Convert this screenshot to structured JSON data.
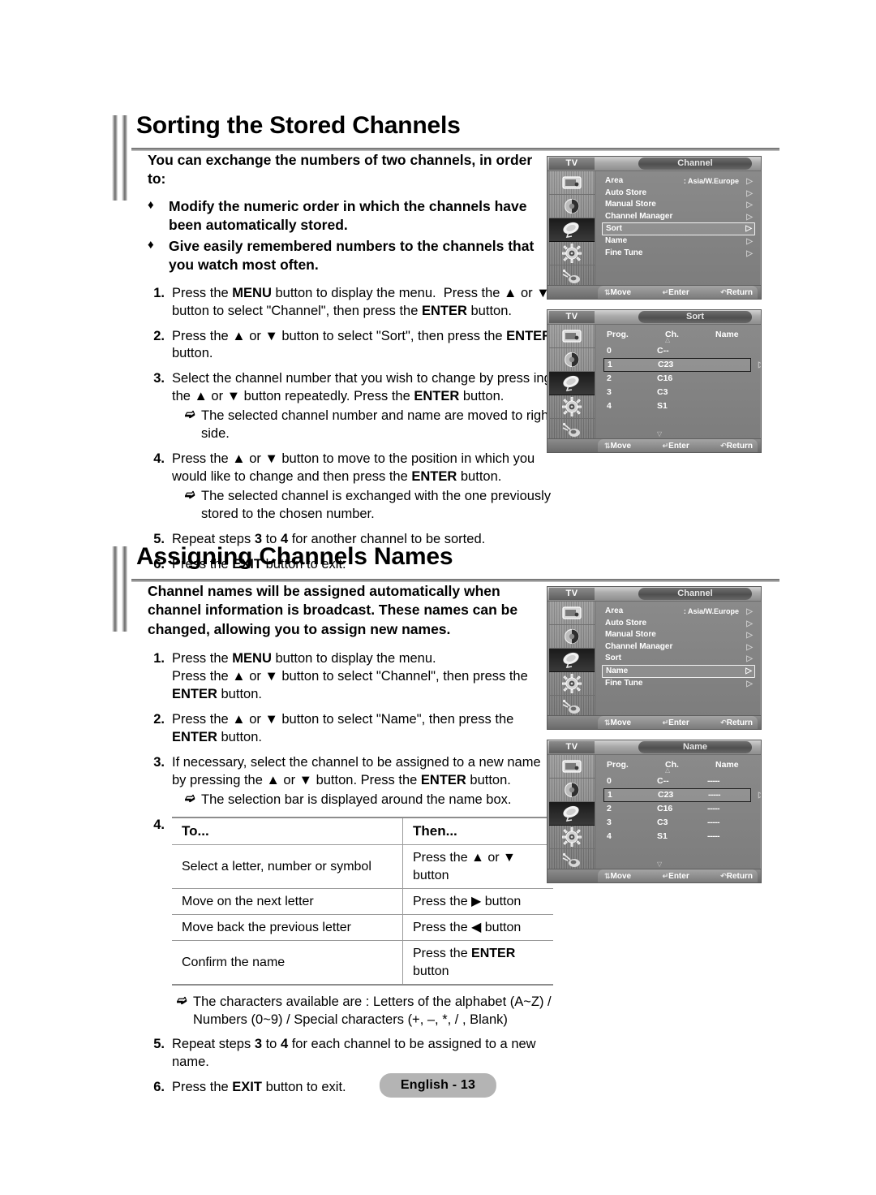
{
  "page": {
    "footer_badge": "English - 13"
  },
  "sections": [
    {
      "heading": "Sorting the Stored Channels",
      "intro": "You can exchange the numbers of two channels, in order to:",
      "bullet_marker": "♦",
      "bullets": [
        "Modify the numeric order in which the channels have been automatically stored.",
        "Give easily remembered numbers to the channels that you watch most often."
      ],
      "steps": [
        {
          "num": "1.",
          "html": "Press the <b>MENU</b> button to display the menu.&nbsp; Press the ▲ or ▼ button to select \"Channel\", then press the <b>ENTER</b> button."
        },
        {
          "num": "2.",
          "html": "Press the ▲ or ▼ button to select \"Sort\", then press the <b>ENTER</b> button."
        },
        {
          "num": "3.",
          "html": "Select the channel number that you wish to change by press ing the ▲ or ▼ button repeatedly. Press the <b>ENTER</b> button.",
          "note": "The selected channel number and name are moved to right side."
        },
        {
          "num": "4.",
          "html": "Press the ▲ or ▼ button to move to the position in which you would like to change and then press the <b>ENTER</b> button.",
          "note": "The selected channel is exchanged with the one previously stored to the chosen number."
        },
        {
          "num": "5.",
          "html": "Repeat steps <b>3</b> to <b>4</b> for another channel to be sorted."
        },
        {
          "num": "6.",
          "html": "Press the <b>EXIT</b> button to exit."
        }
      ]
    },
    {
      "heading": "Assigning Channels Names",
      "intro": "Channel names will be assigned automatically when channel information is broadcast. These names can be changed, allowing you to assign new names.",
      "steps": [
        {
          "num": "1.",
          "html": "Press the <b>MENU</b> button to display the menu.<br>Press the ▲ or ▼ button to select \"Channel\", then press the <b>ENTER</b> button."
        },
        {
          "num": "2.",
          "html": "Press the ▲ or ▼ button to select \"Name\", then press the <b>ENTER</b> button."
        },
        {
          "num": "3.",
          "html": "If necessary, select the channel to be assigned to a new name by pressing the ▲ or ▼ button. Press the <b>ENTER</b> button.",
          "note": "The selection bar is displayed around the name box."
        }
      ],
      "table_step_num": "4.",
      "table": {
        "headers": [
          "To...",
          "Then..."
        ],
        "rows": [
          {
            "to": "Select a letter, number or symbol",
            "then": "Press the ▲ or ▼ button"
          },
          {
            "to": "Move on the next letter",
            "then": "Press the ▶ button"
          },
          {
            "to": "Move back the previous letter",
            "then": "Press the ◀ button"
          },
          {
            "to": "Confirm the name",
            "then": "Press the <b>ENTER</b> button"
          }
        ]
      },
      "after_table_note": "The characters available are : Letters of the alphabet (A~Z) / Numbers (0~9) / Special characters (+, –, *, / , Blank)",
      "steps_after": [
        {
          "num": "5.",
          "html": "Repeat steps <b>3</b> to <b>4</b> for each channel to be assigned to a new name."
        },
        {
          "num": "6.",
          "html": "Press the <b>EXIT</b> button to exit."
        }
      ]
    }
  ],
  "osd_common": {
    "tv_label": "TV",
    "footer": {
      "move": "Move",
      "enter": "Enter",
      "return": "Return"
    },
    "sidebar_icons": [
      "picture-icon",
      "sound-icon",
      "channel-dish-icon",
      "setup-gear-icon",
      "input-source-icon"
    ]
  },
  "osd_menus": [
    {
      "id": "channel-menu-sort",
      "title": "Channel",
      "kind": "list",
      "selected_sidebar_index": 2,
      "rows": [
        {
          "label": "Area",
          "value": ": Asia/W.Europe",
          "selected": false
        },
        {
          "label": "Auto Store",
          "value": "",
          "selected": false
        },
        {
          "label": "Manual Store",
          "value": "",
          "selected": false
        },
        {
          "label": "Channel Manager",
          "value": "",
          "selected": false
        },
        {
          "label": "Sort",
          "value": "",
          "selected": true
        },
        {
          "label": "Name",
          "value": "",
          "selected": false
        },
        {
          "label": "Fine Tune",
          "value": "",
          "selected": false
        }
      ]
    },
    {
      "id": "sort-menu",
      "title": "Sort",
      "kind": "table",
      "selected_sidebar_index": 2,
      "columns": [
        "Prog.",
        "Ch.",
        "Name"
      ],
      "rows": [
        {
          "prog": "0",
          "ch": "C--",
          "name": "",
          "selected": false
        },
        {
          "prog": "1",
          "ch": "C23",
          "name": "",
          "selected": true
        },
        {
          "prog": "2",
          "ch": "C16",
          "name": "",
          "selected": false
        },
        {
          "prog": "3",
          "ch": "C3",
          "name": "",
          "selected": false
        },
        {
          "prog": "4",
          "ch": "S1",
          "name": "",
          "selected": false
        }
      ]
    },
    {
      "id": "channel-menu-name",
      "title": "Channel",
      "kind": "list",
      "selected_sidebar_index": 2,
      "rows": [
        {
          "label": "Area",
          "value": ": Asia/W.Europe",
          "selected": false
        },
        {
          "label": "Auto Store",
          "value": "",
          "selected": false
        },
        {
          "label": "Manual Store",
          "value": "",
          "selected": false
        },
        {
          "label": "Channel Manager",
          "value": "",
          "selected": false
        },
        {
          "label": "Sort",
          "value": "",
          "selected": false
        },
        {
          "label": "Name",
          "value": "",
          "selected": true
        },
        {
          "label": "Fine Tune",
          "value": "",
          "selected": false
        }
      ]
    },
    {
      "id": "name-menu",
      "title": "Name",
      "kind": "table",
      "selected_sidebar_index": 2,
      "columns": [
        "Prog.",
        "Ch.",
        "Name"
      ],
      "rows": [
        {
          "prog": "0",
          "ch": "C--",
          "name": "-----",
          "selected": false
        },
        {
          "prog": "1",
          "ch": "C23",
          "name": "-----",
          "selected": true
        },
        {
          "prog": "2",
          "ch": "C16",
          "name": "-----",
          "selected": false
        },
        {
          "prog": "3",
          "ch": "C3",
          "name": "-----",
          "selected": false
        },
        {
          "prog": "4",
          "ch": "S1",
          "name": "-----",
          "selected": false
        }
      ]
    }
  ]
}
